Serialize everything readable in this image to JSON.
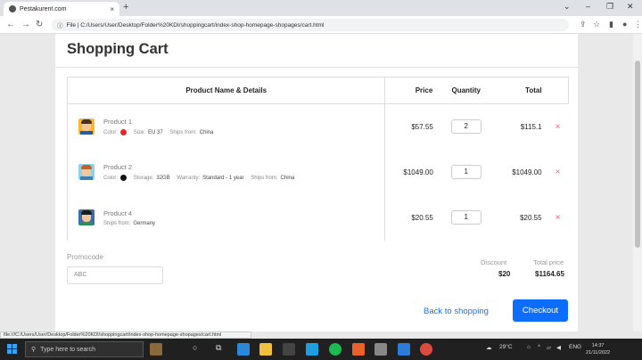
{
  "browser": {
    "tab_title": "Pestakurent.com",
    "tab_close": "×",
    "new_tab": "+",
    "url": "File | C:/Users/User/Desktop/Folder%20KDI/shoppingcart/index-shop-homepage-shopages/cart.html",
    "url_prefix": "ⓘ"
  },
  "page": {
    "title": "Shopping Cart",
    "columns": {
      "product": "Product Name & Details",
      "price": "Price",
      "quantity": "Quantity",
      "total": "Total"
    },
    "items": [
      {
        "name": "Product 1",
        "meta": [
          {
            "label": "Color:",
            "dot": "#e8252a"
          },
          {
            "label": "Size:",
            "value": "EU 37"
          },
          {
            "label": "Ships from:",
            "value": "China"
          }
        ],
        "price": "$57.55",
        "qty": "2",
        "total": "$115.1",
        "remove": "×",
        "avatar": {
          "bg": "#f7b733",
          "hair": "#4a3020",
          "body": "#2c5aa0"
        }
      },
      {
        "name": "Product 2",
        "meta": [
          {
            "label": "Color:",
            "dot": "#111111"
          },
          {
            "label": "Storage:",
            "value": "32GB"
          },
          {
            "label": "Warranty:",
            "value": "Standard - 1 year"
          },
          {
            "label": "Ships from:",
            "value": "China"
          }
        ],
        "price": "$1049.00",
        "qty": "1",
        "total": "$1049.00",
        "remove": "×",
        "avatar": {
          "bg": "#8fd3e8",
          "hair": "#c0602a",
          "body": "#3d7fb5"
        }
      },
      {
        "name": "Product 4",
        "meta": [
          {
            "label": "Ships from:",
            "value": "Germany"
          }
        ],
        "price": "$20.55",
        "qty": "1",
        "total": "$20.55",
        "remove": "×",
        "avatar": {
          "bg": "#3b6fa8",
          "hair": "#1d1d1d",
          "body": "#2f8f5a"
        }
      }
    ],
    "promo": {
      "label": "Promocode",
      "value": "ABC"
    },
    "summary": {
      "discount_label": "Discount",
      "discount_value": "$20",
      "total_label": "Total price",
      "total_value": "$1164.65"
    },
    "back_link": "Back to shopping",
    "checkout": "Checkout"
  },
  "status_url": "file:///C:/Users/User/Desktop/Folder%20KDI/shoppingcart/index-shop-homepage-shopages/cart.html",
  "taskbar": {
    "search_placeholder": "Type here to search",
    "weather": "29°C",
    "lang": "ENG",
    "time": "14:37",
    "date": "21/11/2022"
  }
}
